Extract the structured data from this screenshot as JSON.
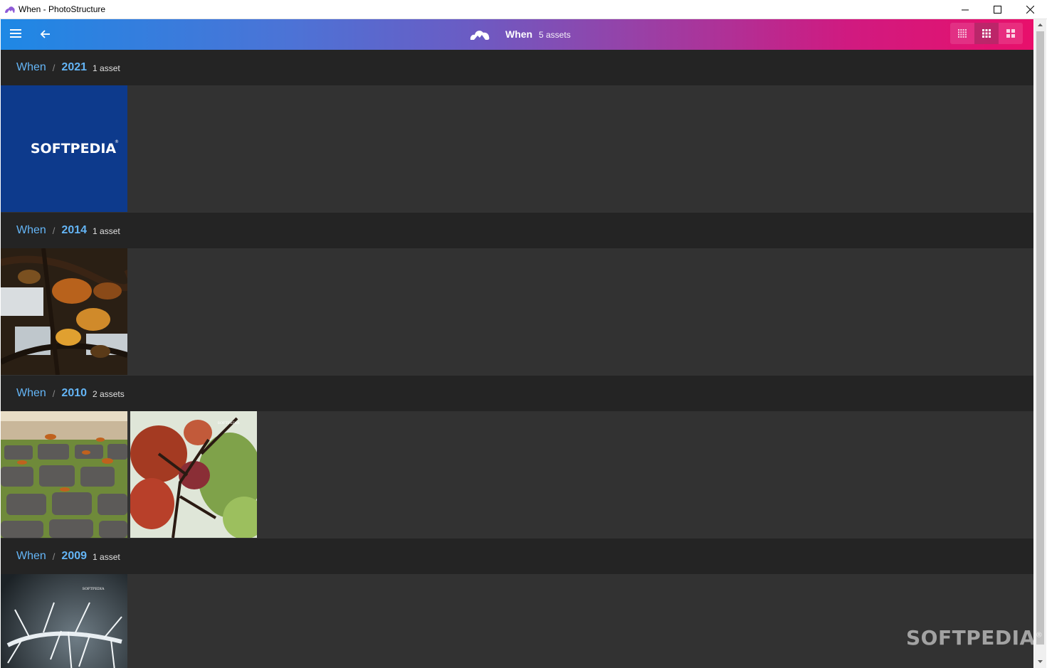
{
  "window": {
    "title": "When - PhotoStructure"
  },
  "appbar": {
    "title": "When",
    "asset_count": "5 assets",
    "view_modes": [
      "small-grid",
      "medium-grid",
      "large-grid"
    ],
    "active_view": "medium-grid"
  },
  "sections": [
    {
      "root": "When",
      "separator": "/",
      "year": "2021",
      "count": "1 asset",
      "thumbnails": [
        {
          "subject": "softpedia-logo",
          "logo_text": "SOFTPEDIA"
        }
      ]
    },
    {
      "root": "When",
      "separator": "/",
      "year": "2014",
      "count": "1 asset",
      "thumbnails": [
        {
          "subject": "autumn-leaves-canopy"
        }
      ]
    },
    {
      "root": "When",
      "separator": "/",
      "year": "2010",
      "count": "2 assets",
      "thumbnails": [
        {
          "subject": "cobblestone-path-leaves"
        },
        {
          "subject": "red-leaves-branch",
          "watermark": "SOFTPEDIA"
        }
      ]
    },
    {
      "root": "When",
      "separator": "/",
      "year": "2009",
      "count": "1 asset",
      "thumbnails": [
        {
          "subject": "frosted-thorns-bw",
          "watermark": "SOFTPEDIA"
        }
      ]
    }
  ],
  "watermark": "SOFTPEDIA",
  "colors": {
    "accent": "#64b5f6",
    "gradient_start": "#1e88e5",
    "gradient_end": "#e8106b",
    "content_bg": "#323232",
    "section_bg": "#242424"
  }
}
